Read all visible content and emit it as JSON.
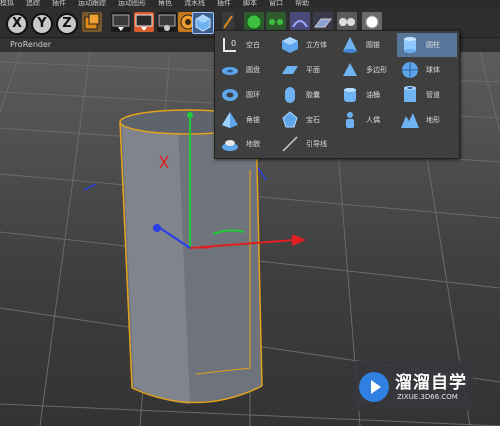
{
  "menubar": {
    "items": [
      "模拟",
      "追踪",
      "插件",
      "运动跟踪",
      "运动图形",
      "角色",
      "流水线",
      "插件",
      "脚本",
      "窗口",
      "帮助"
    ]
  },
  "toolbar": {
    "axis_labels": [
      "X",
      "Y",
      "Z"
    ],
    "icons": [
      "coordinate-system-icon",
      "render-view-icon",
      "render-picture-viewer-icon",
      "edit-render-settings-icon",
      "cube-object-icon",
      "pen-icon",
      "subdivision-icon",
      "array-icon",
      "deformer-icon",
      "floor-icon",
      "camera-icon",
      "light-icon"
    ]
  },
  "tabbar": {
    "label": "ProRender"
  },
  "object_menu": {
    "items": [
      {
        "label": "空白",
        "icon": "null-object-icon"
      },
      {
        "label": "立方体",
        "icon": "cube-icon"
      },
      {
        "label": "圆锥",
        "icon": "cone-icon"
      },
      {
        "label": "圆柱",
        "icon": "cylinder-icon",
        "selected": true
      },
      {
        "label": "圆盘",
        "icon": "disc-icon"
      },
      {
        "label": "平面",
        "icon": "plane-icon"
      },
      {
        "label": "多边形",
        "icon": "polygon-icon"
      },
      {
        "label": "球体",
        "icon": "sphere-icon"
      },
      {
        "label": "圆环",
        "icon": "torus-icon"
      },
      {
        "label": "胶囊",
        "icon": "capsule-icon"
      },
      {
        "label": "油桶",
        "icon": "oil-tank-icon"
      },
      {
        "label": "管道",
        "icon": "tube-icon"
      },
      {
        "label": "角锥",
        "icon": "pyramid-icon"
      },
      {
        "label": "宝石",
        "icon": "platonic-icon"
      },
      {
        "label": "人偶",
        "icon": "figure-icon"
      },
      {
        "label": "地形",
        "icon": "landscape-icon"
      },
      {
        "label": "地貌",
        "icon": "relief-icon"
      },
      {
        "label": "引导线",
        "icon": "guide-icon"
      }
    ]
  },
  "colors": {
    "selection": "#58759a",
    "object_outline": "#e3a21a",
    "axis_x": "#e02020",
    "axis_y": "#22c93a",
    "axis_z": "#2a3fe6",
    "menu_bg": "#3f3f3f"
  },
  "watermark": {
    "title": "溜溜自学",
    "url": "ZIXUE.3D66.COM"
  }
}
